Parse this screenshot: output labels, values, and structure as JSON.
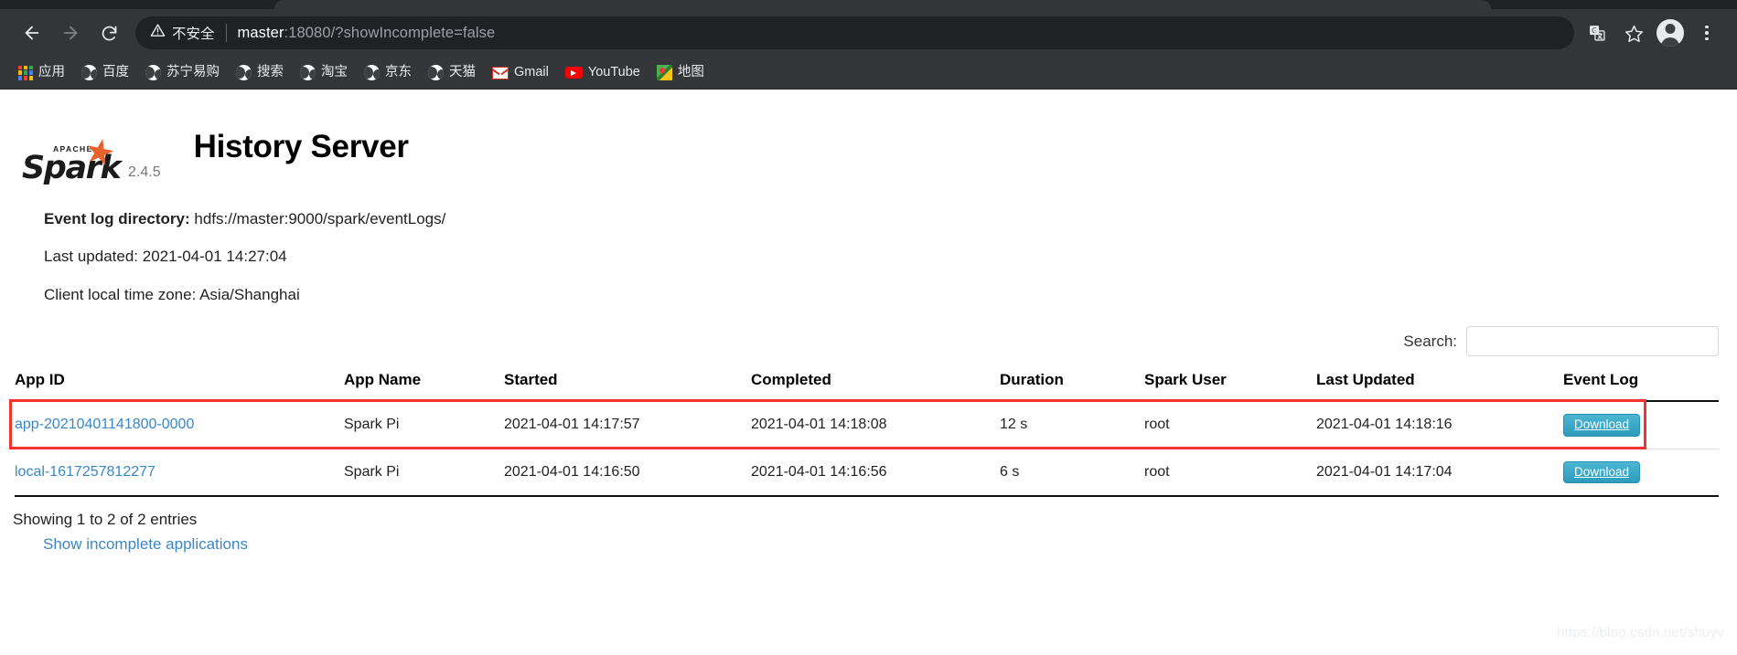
{
  "browser": {
    "nav": {
      "back_label": "Back",
      "forward_label": "Forward",
      "reload_label": "Reload"
    },
    "omnibox": {
      "security_icon": "warning-triangle-icon",
      "security_label": "不安全",
      "url_host": "master",
      "url_rest": ":18080/?showIncomplete=false",
      "full_url": "master:18080/?showIncomplete=false"
    },
    "toolbar_right": [
      {
        "name": "translate-icon",
        "label": "Translate"
      },
      {
        "name": "bookmark-star-icon",
        "label": "Bookmark"
      },
      {
        "name": "profile-avatar",
        "label": "Profile"
      },
      {
        "name": "chrome-menu-icon",
        "label": "Customize and control"
      }
    ],
    "bookmarks": [
      {
        "label": "应用",
        "icon": "apps-grid-icon"
      },
      {
        "label": "百度",
        "icon": "globe-icon"
      },
      {
        "label": "苏宁易购",
        "icon": "globe-icon"
      },
      {
        "label": "搜索",
        "icon": "globe-icon"
      },
      {
        "label": "淘宝",
        "icon": "globe-icon"
      },
      {
        "label": "京东",
        "icon": "globe-icon"
      },
      {
        "label": "天猫",
        "icon": "globe-icon"
      },
      {
        "label": "Gmail",
        "icon": "gmail-icon"
      },
      {
        "label": "YouTube",
        "icon": "youtube-icon"
      },
      {
        "label": "地图",
        "icon": "map-icon"
      }
    ]
  },
  "page": {
    "logo": {
      "apache_text": "APACHE",
      "wordmark": "Spark",
      "version": "2.4.5"
    },
    "title": "History Server",
    "meta": {
      "event_log_dir_label": "Event log directory:",
      "event_log_dir_value": "hdfs://master:9000/spark/eventLogs/",
      "last_updated": "Last updated: 2021-04-01 14:27:04",
      "time_zone": "Client local time zone: Asia/Shanghai"
    },
    "search": {
      "label": "Search:",
      "value": "",
      "placeholder": ""
    },
    "table": {
      "columns": [
        "App ID",
        "App Name",
        "Started",
        "Completed",
        "Duration",
        "Spark User",
        "Last Updated",
        "Event Log"
      ],
      "rows": [
        {
          "app_id": "app-20210401141800-0000",
          "app_name": "Spark Pi",
          "started": "2021-04-01 14:17:57",
          "completed": "2021-04-01 14:18:08",
          "duration": "12 s",
          "spark_user": "root",
          "last_updated": "2021-04-01 14:18:16",
          "event_log": "Download",
          "highlighted": true
        },
        {
          "app_id": "local-1617257812277",
          "app_name": "Spark Pi",
          "started": "2021-04-01 14:16:50",
          "completed": "2021-04-01 14:16:56",
          "duration": "6 s",
          "spark_user": "root",
          "last_updated": "2021-04-01 14:17:04",
          "event_log": "Download",
          "highlighted": false
        }
      ]
    },
    "footer": {
      "showing": "Showing 1 to 2 of 2 entries",
      "incomplete_link": "Show incomplete applications"
    },
    "watermark": "https://blog.csdn.net/shuyv",
    "colors": {
      "link": "#3a87c8",
      "download_button": "#36a3c4",
      "highlight_border": "#f4332f",
      "spark_orange": "#e8622c"
    }
  }
}
